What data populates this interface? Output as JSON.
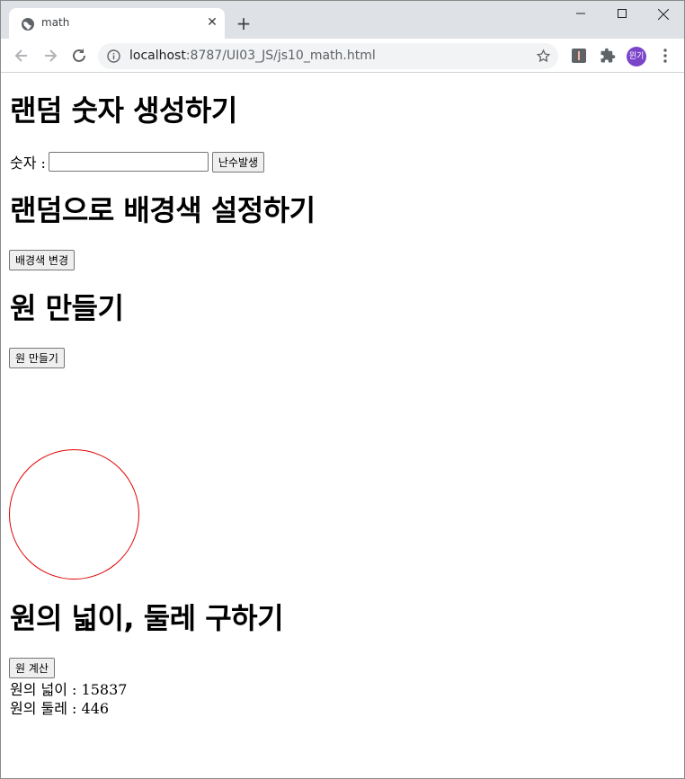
{
  "browser": {
    "tab_title": "math",
    "url_host": "localhost",
    "url_rest": ":8787/UI03_JS/js10_math.html",
    "profile_label": "윈기"
  },
  "page": {
    "random_number": {
      "heading": "랜덤 숫자 생성하기",
      "label": "숫자 :",
      "input_value": "",
      "button": "난수발생"
    },
    "random_bg": {
      "heading": "랜덤으로 배경색 설정하기",
      "button": "배경색 변경"
    },
    "make_circle": {
      "heading": "원 만들기",
      "button": "원 만들기",
      "circle_color": "#e00000"
    },
    "circle_calc": {
      "heading": "원의 넓이, 둘레 구하기",
      "button": "원 계산",
      "area_text": "원의 넓이 : 15837",
      "perimeter_text": "원의 둘레 : 446"
    }
  }
}
